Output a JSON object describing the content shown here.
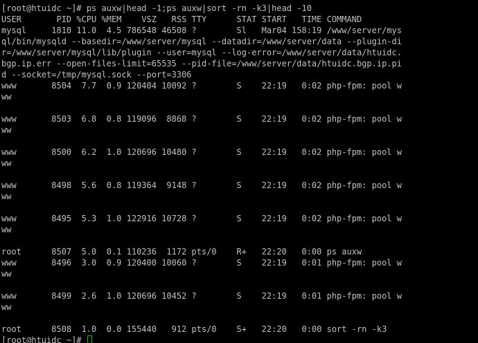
{
  "terminal": {
    "lines": [
      "[root@htuidc ~]# ps auxw|head -1;ps auxw|sort -rn -k3|head -10",
      "USER       PID %CPU %MEM    VSZ   RSS TTY      STAT START   TIME COMMAND",
      "mysql     1810 11.0  4.5 786548 46508 ?        Sl   Mar04 158:19 /www/server/mys",
      "ql/bin/mysqld --basedir=/www/server/mysql --datadir=/www/server/data --plugin-di",
      "r=/www/server/mysql/lib/plugin --user=mysql --log-error=/www/server/data/htuidc.",
      "bgp.ip.err --open-files-limit=65535 --pid-file=/www/server/data/htuidc.bgp.ip.pi",
      "d --socket=/tmp/mysql.sock --port=3306",
      "www       8504  7.7  0.9 120404 10092 ?        S    22:19   0:02 php-fpm: pool w",
      "ww",
      "",
      "www       8503  6.8  0.8 119096  8868 ?        S    22:19   0:02 php-fpm: pool w",
      "ww",
      "",
      "www       8500  6.2  1.0 120696 10480 ?        S    22:19   0:02 php-fpm: pool w",
      "ww",
      "",
      "www       8498  5.6  0.8 119364  9148 ?        S    22:19   0:02 php-fpm: pool w",
      "ww",
      "",
      "www       8495  5.3  1.0 122916 10728 ?        S    22:19   0:02 php-fpm: pool w",
      "ww",
      "",
      "root      8507  5.0  0.1 110236  1172 pts/0    R+   22:20   0:00 ps auxw",
      "www       8496  3.0  0.9 120400 10060 ?        S    22:19   0:01 php-fpm: pool w",
      "ww",
      "",
      "www       8499  2.6  1.0 120696 10452 ?        S    22:19   0:01 php-fpm: pool w",
      "ww",
      "",
      "root      8508  1.0  0.0 155440   912 pts/0    S+   22:20   0:00 sort -rn -k3"
    ],
    "prompt": "[root@htuidc ~]# ",
    "cursor_color": "#00c000",
    "text_color": "#c0c0c0",
    "background_color": "#000000"
  }
}
